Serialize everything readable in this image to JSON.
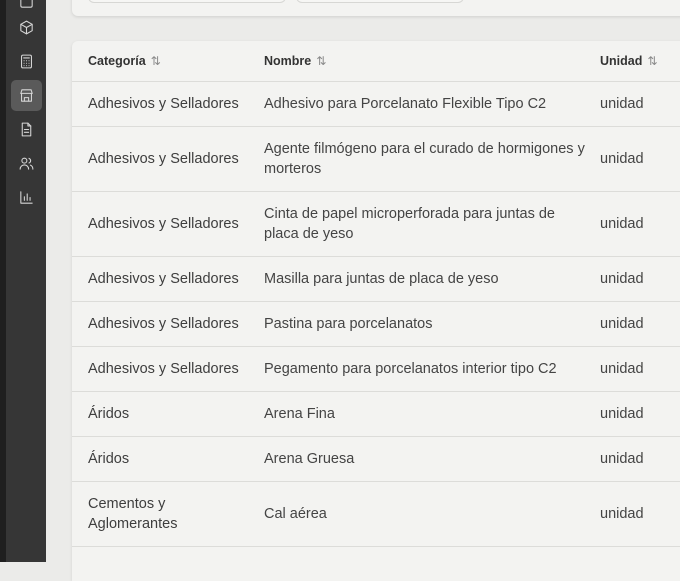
{
  "sidebar": {
    "items": [
      {
        "icon": "box-icon",
        "active": false
      },
      {
        "icon": "calculator-icon",
        "active": false
      },
      {
        "icon": "store-icon",
        "active": true
      },
      {
        "icon": "document-icon",
        "active": false
      },
      {
        "icon": "users-icon",
        "active": false
      },
      {
        "icon": "bar-chart-icon",
        "active": false
      }
    ]
  },
  "table": {
    "columns": [
      {
        "label": "Categoría",
        "sort_icon": "⇅"
      },
      {
        "label": "Nombre",
        "sort_icon": "⇅"
      },
      {
        "label": "Unidad",
        "sort_icon": "⇅"
      }
    ],
    "rows": [
      {
        "categoria": "Adhesivos y Selladores",
        "nombre": "Adhesivo para Porcelanato Flexible Tipo C2",
        "unidad": "unidad"
      },
      {
        "categoria": "Adhesivos y Selladores",
        "nombre": "Agente filmógeno para el curado de hormigones y morteros",
        "unidad": "unidad"
      },
      {
        "categoria": "Adhesivos y Selladores",
        "nombre": "Cinta de papel microperforada para juntas de placa de yeso",
        "unidad": "unidad"
      },
      {
        "categoria": "Adhesivos y Selladores",
        "nombre": "Masilla para juntas de placa de yeso",
        "unidad": "unidad"
      },
      {
        "categoria": "Adhesivos y Selladores",
        "nombre": "Pastina para porcelanatos",
        "unidad": "unidad"
      },
      {
        "categoria": "Adhesivos y Selladores",
        "nombre": "Pegamento para porcelanatos interior tipo C2",
        "unidad": "unidad"
      },
      {
        "categoria": "Áridos",
        "nombre": "Arena Fina",
        "unidad": "unidad"
      },
      {
        "categoria": "Áridos",
        "nombre": "Arena Gruesa",
        "unidad": "unidad"
      },
      {
        "categoria": "Cementos y Aglomerantes",
        "nombre": "Cal aérea",
        "unidad": "unidad"
      }
    ]
  }
}
